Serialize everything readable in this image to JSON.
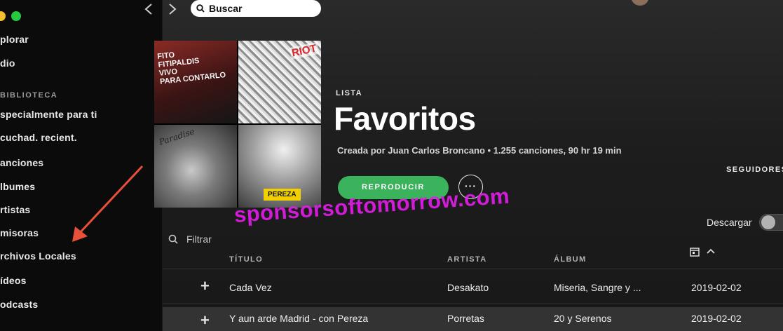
{
  "sidebar": {
    "nav": [
      {
        "label": "plorar"
      },
      {
        "label": "dio"
      }
    ],
    "library_heading": "BIBLIOTECA",
    "library": [
      {
        "label": "specialmente para ti"
      },
      {
        "label": "cuchad. recient."
      },
      {
        "label": "anciones"
      },
      {
        "label": "lbumes"
      },
      {
        "label": "rtistas"
      },
      {
        "label": "misoras"
      },
      {
        "label": "rchivos Locales"
      },
      {
        "label": "ídeos"
      },
      {
        "label": "odcasts"
      }
    ]
  },
  "topbar": {
    "search_label": "Buscar"
  },
  "playlist": {
    "type": "LISTA",
    "title": "Favoritos",
    "meta": "Creada por Juan Carlos Broncano • 1.255 canciones, 90 hr 19 min",
    "play_label": "REPRODUCIR",
    "more_label": "···",
    "followers_label": "SEGUIDORES",
    "cover_texts": {
      "fito": "FITO\nFITIPALDIS\nVIVO\nPARA CONTARLO",
      "riot": "RIOT",
      "sig": "Paradise",
      "pereza": "PEREZA"
    }
  },
  "controls": {
    "filter_label": "Filtrar",
    "download_label": "Descargar",
    "download_on": false
  },
  "table": {
    "headers": {
      "title": "TÍTULO",
      "artist": "ARTISTA",
      "album": "ÁLBUM"
    },
    "rows": [
      {
        "title": "Cada Vez",
        "artist": "Desakato",
        "album": "Miseria, Sangre y ...",
        "date": "2019-02-02"
      },
      {
        "title": "Y aun arde Madrid - con Pereza",
        "artist": "Porretas",
        "album": "20 y Serenos",
        "date": "2019-02-02"
      }
    ]
  },
  "watermark": "sponsorsoftomorrow.com",
  "colors": {
    "accent_green": "#3bb25c",
    "watermark": "#e11de8",
    "arrow": "#e8503a"
  }
}
